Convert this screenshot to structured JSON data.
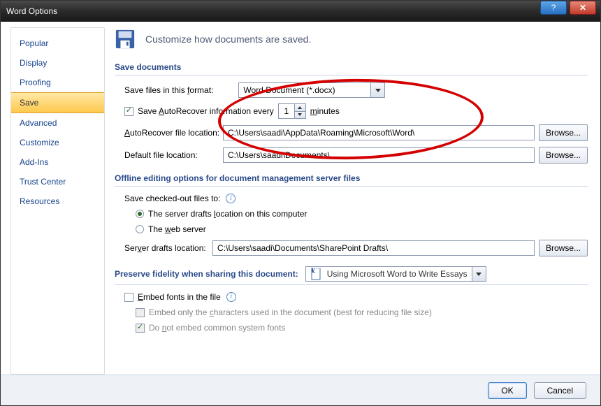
{
  "titlebar": {
    "title": "Word Options"
  },
  "sidebar": {
    "items": [
      {
        "label": "Popular"
      },
      {
        "label": "Display"
      },
      {
        "label": "Proofing"
      },
      {
        "label": "Save"
      },
      {
        "label": "Advanced"
      },
      {
        "label": "Customize"
      },
      {
        "label": "Add-Ins"
      },
      {
        "label": "Trust Center"
      },
      {
        "label": "Resources"
      }
    ],
    "selected_index": 3
  },
  "header": {
    "text": "Customize how documents are saved."
  },
  "section_save": {
    "title": "Save documents",
    "format_label_pre": "Save files in this ",
    "format_label_u": "f",
    "format_label_post": "ormat:",
    "format_value": "Word Document (*.docx)",
    "autorecover_checked": true,
    "autorecover_label_pre": "Save ",
    "autorecover_label_u": "A",
    "autorecover_label_mid": "utoRecover information every",
    "autorecover_minutes": "1",
    "minutes_u": "m",
    "minutes_post": "inutes",
    "ar_loc_label_u": "A",
    "ar_loc_label_post": "utoRecover file location:",
    "ar_loc_value": "C:\\Users\\saadi\\AppData\\Roaming\\Microsoft\\Word\\",
    "def_loc_label": "Default file location:",
    "def_loc_value": "C:\\Users\\saadi\\Documents\\",
    "browse_label": "Browse..."
  },
  "section_offline": {
    "title": "Offline editing options for document management server files",
    "save_checked_label": "Save checked-out files to:",
    "radio1_pre": "The server drafts ",
    "radio1_u": "l",
    "radio1_post": "ocation on this computer",
    "radio2_pre": "The ",
    "radio2_u": "w",
    "radio2_post": "eb server",
    "radio_selected": 0,
    "drafts_label_pre": "Ser",
    "drafts_label_u": "v",
    "drafts_label_post": "er drafts location:",
    "drafts_value": "C:\\Users\\saadi\\Documents\\SharePoint Drafts\\",
    "browse_label": "Browse..."
  },
  "section_preserve": {
    "title": "Preserve fidelity when sharing this document:",
    "doc_value": "Using Microsoft Word to Write Essays",
    "embed_checked": false,
    "embed_label_u": "E",
    "embed_label_post": "mbed fonts in the file",
    "sub1_pre": "Embed only the ",
    "sub1_u": "c",
    "sub1_post": "haracters used in the document (best for reducing file size)",
    "sub2_pre": "Do ",
    "sub2_u": "n",
    "sub2_post": "ot embed common system fonts"
  },
  "footer": {
    "ok": "OK",
    "cancel": "Cancel"
  }
}
